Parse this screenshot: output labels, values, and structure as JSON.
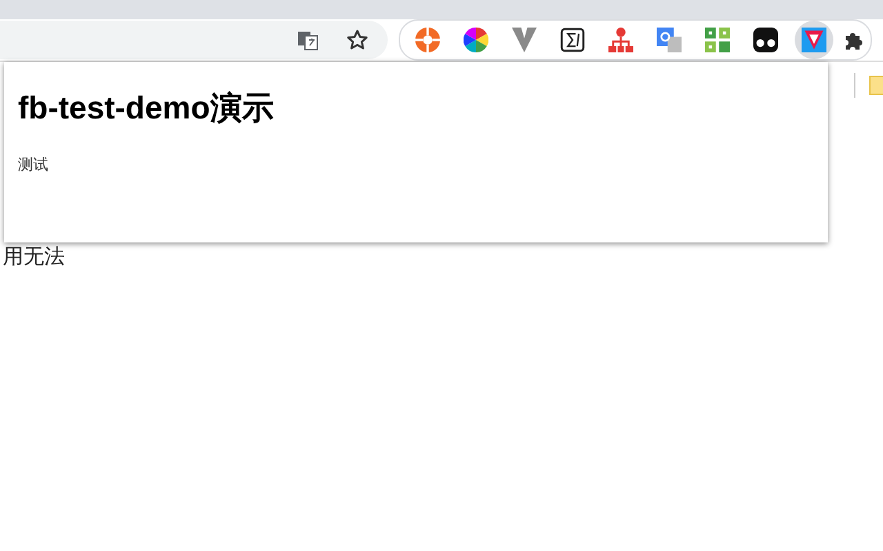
{
  "toolbar": {
    "extensions": [
      {
        "kind": "ring",
        "selected": false
      },
      {
        "kind": "wheel",
        "selected": false
      },
      {
        "kind": "vee",
        "selected": false
      },
      {
        "kind": "sigma",
        "selected": false
      },
      {
        "kind": "tree",
        "selected": false
      },
      {
        "kind": "translate",
        "selected": false
      },
      {
        "kind": "grid",
        "selected": false
      },
      {
        "kind": "mask",
        "selected": false
      },
      {
        "kind": "shield",
        "selected": true
      }
    ]
  },
  "popup": {
    "title": "fb-test-demo演示",
    "body": "测试"
  },
  "page": {
    "lines": [
      "用无法"
    ]
  }
}
